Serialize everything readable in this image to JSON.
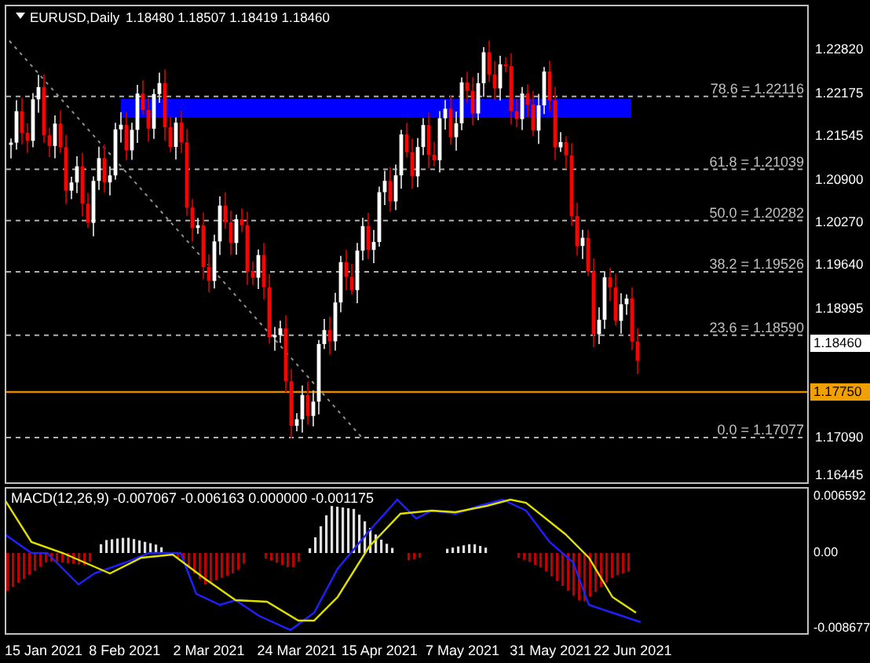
{
  "chart": {
    "symbol": "EURUSD,Daily",
    "ohlc": "1.18480 1.18507 1.18419 1.18460",
    "price_axis": [
      "1.22820",
      "1.22175",
      "1.21545",
      "1.20900",
      "1.20270",
      "1.19640",
      "1.18995",
      "1.17090",
      "1.16445"
    ],
    "current_price": "1.18460",
    "line_price": "1.17750",
    "fib_levels": [
      {
        "label": "78.6 = 1.22116"
      },
      {
        "label": "61.8 = 1.21039"
      },
      {
        "label": "50.0 = 1.20282"
      },
      {
        "label": "38.2 = 1.19526"
      },
      {
        "label": "23.6 = 1.18590"
      },
      {
        "label": "0.0 = 1.17077"
      }
    ]
  },
  "macd": {
    "label": "MACD(12,26,9) -0.007067 -0.006163 0.000000 -0.001175",
    "axis": [
      "0.006592",
      "0.00",
      "-0.008677"
    ]
  },
  "dates": [
    "15 Jan 2021",
    "8 Feb 2021",
    "2 Mar 2021",
    "24 Mar 2021",
    "15 Apr 2021",
    "7 May 2021",
    "31 May 2021",
    "22 Jun 2021"
  ]
}
